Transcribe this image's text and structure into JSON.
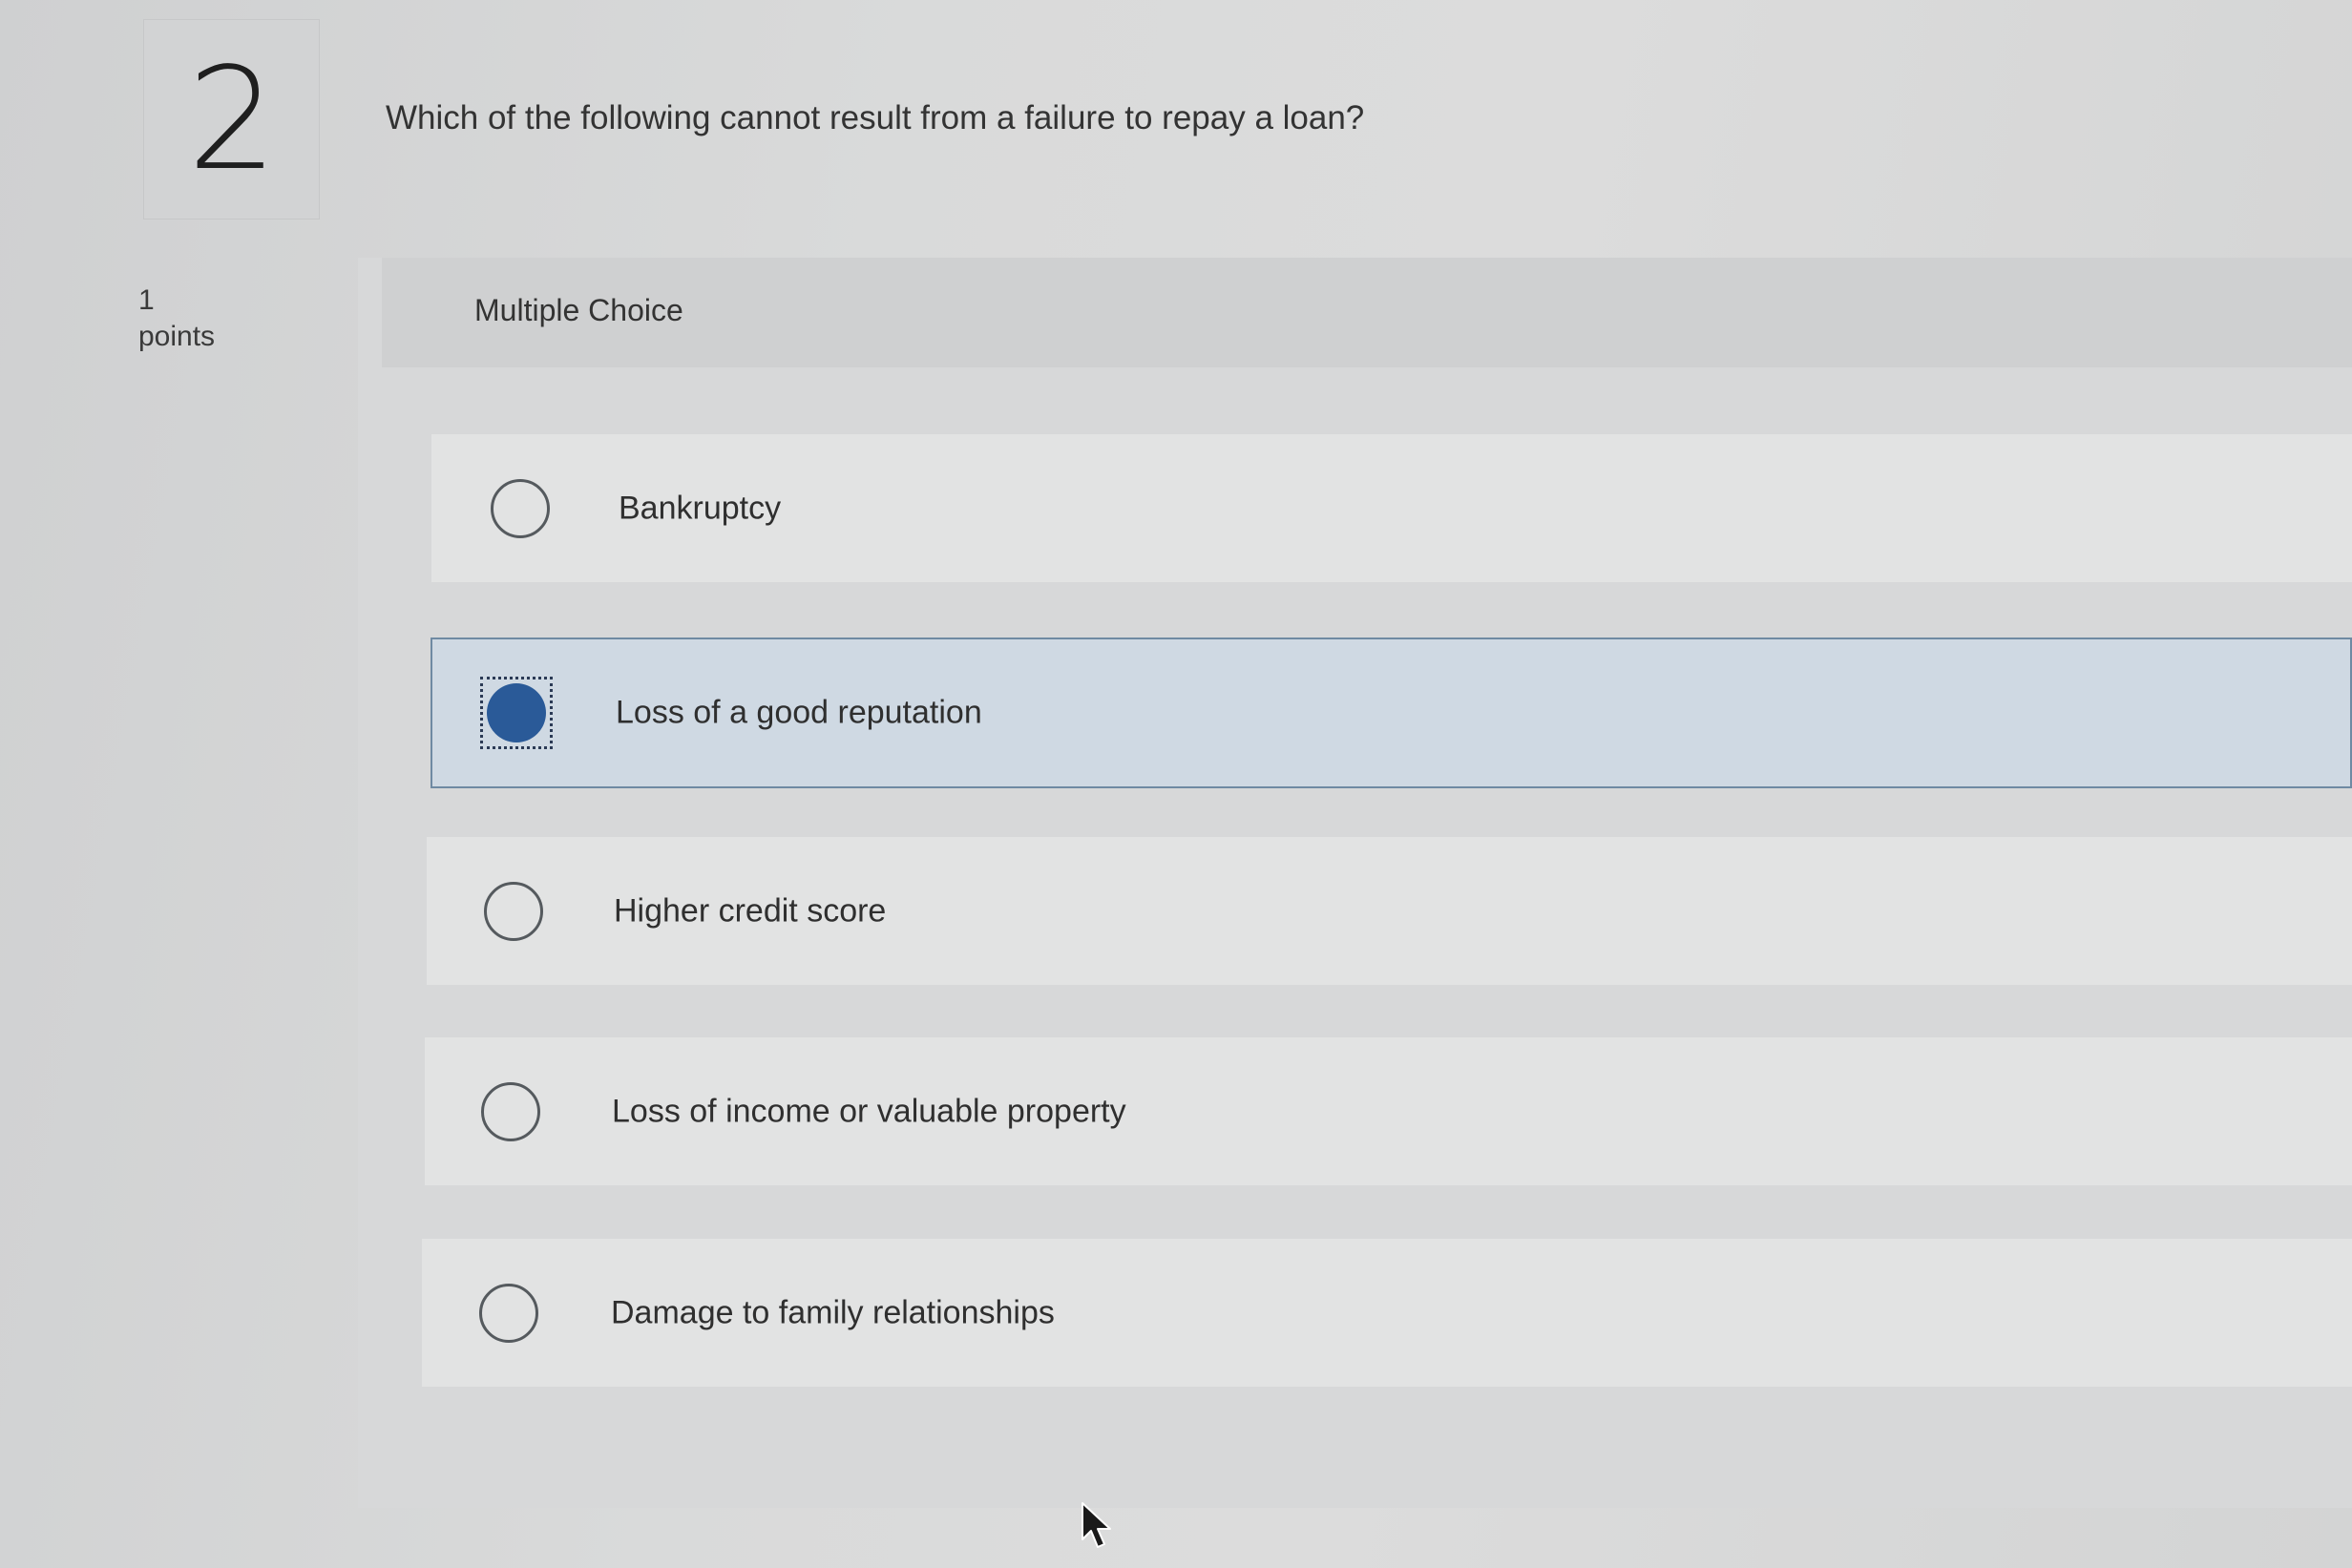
{
  "question": {
    "number": "2",
    "prompt": "Which of the following cannot result from a failure to repay a loan?",
    "points_value": "1",
    "points_label": "points",
    "type_label": "Multiple Choice"
  },
  "options": [
    {
      "label": "Bankruptcy",
      "selected": false
    },
    {
      "label": "Loss of a good reputation",
      "selected": true
    },
    {
      "label": "Higher credit score",
      "selected": false
    },
    {
      "label": "Loss of income or valuable property",
      "selected": false
    },
    {
      "label": "Damage to family relationships",
      "selected": false
    }
  ],
  "colors": {
    "selected_fill": "#2a5a98",
    "selected_row": "#cfd9e3",
    "selected_border": "#6f8aa3"
  },
  "icons": [
    "radio-unchecked-icon",
    "radio-checked-icon",
    "mouse-pointer-icon"
  ]
}
